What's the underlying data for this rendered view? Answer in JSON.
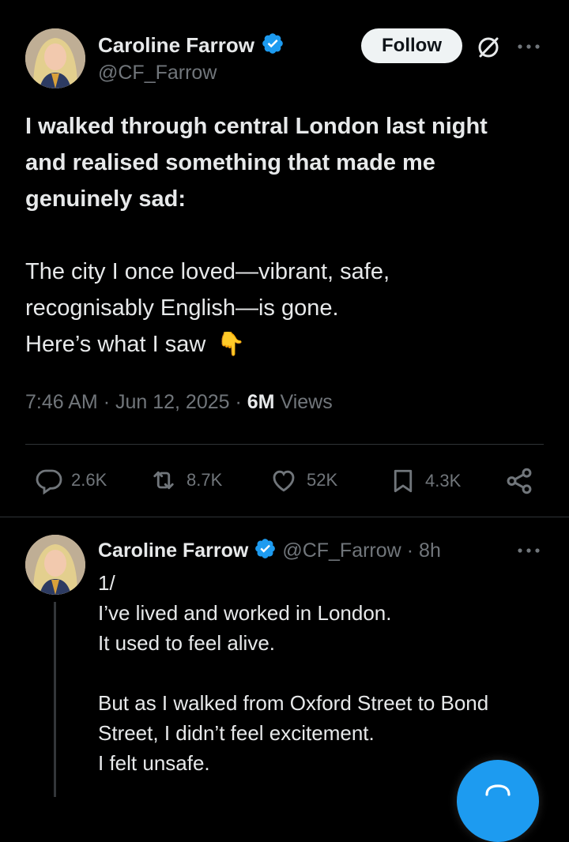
{
  "tweet": {
    "author_name": "Caroline Farrow",
    "author_handle": "@CF_Farrow",
    "follow_label": "Follow",
    "text_bold": [
      "I walked through central London last night",
      "and realised something that made me",
      "genuinely sad:"
    ],
    "text_lines": [
      "The city I once loved—vibrant, safe,",
      "recognisably English—is gone.",
      "Here’s what I saw"
    ],
    "emoji": "👇",
    "time": "7:46 AM",
    "date": "Jun 12, 2025",
    "views_count": "6M",
    "views_label": "Views",
    "separator": "·",
    "actions": {
      "replies": "2.6K",
      "reposts": "8.7K",
      "likes": "52K",
      "bookmarks": "4.3K"
    }
  },
  "reply": {
    "author_name": "Caroline Farrow",
    "author_handle": "@CF_Farrow",
    "age": "8h",
    "separator": "·",
    "lines": [
      "1/",
      "I’ve lived and worked in London.",
      "It used to feel alive.",
      "",
      "But as I walked from Oxford Street to Bond",
      "Street, I didn’t feel excitement.",
      "I felt unsafe."
    ]
  },
  "colors": {
    "background": "#000000",
    "text": "#e7e9ea",
    "muted": "#71767b",
    "verified_blue": "#1d9bf0",
    "divider": "#2f3336"
  },
  "icons": [
    "verified-badge-icon",
    "grok-icon",
    "more-icon",
    "reply-icon",
    "repost-icon",
    "like-icon",
    "bookmark-icon",
    "share-icon",
    "compose-fab-icon"
  ]
}
